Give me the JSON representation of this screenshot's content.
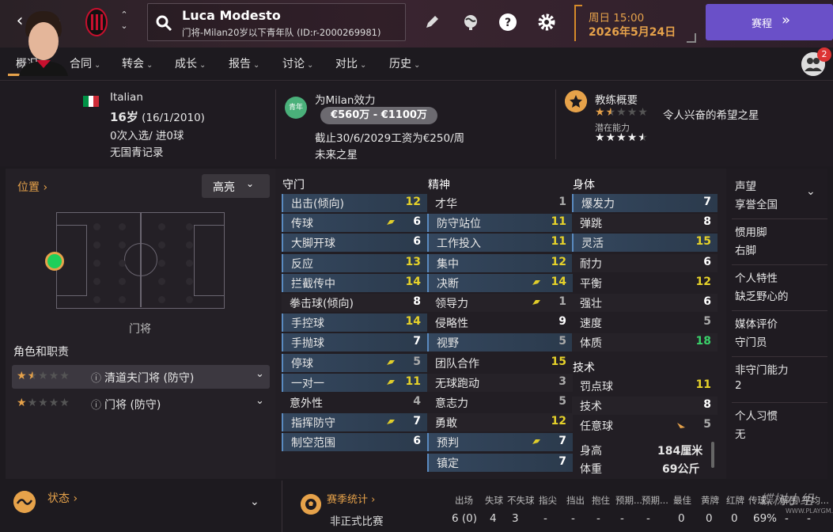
{
  "topbar": {
    "player_name": "Luca Modesto",
    "player_sub": "门将-Milan20岁以下青年队 (ID:r-2000269981)",
    "date_line1": "周日 15:00",
    "date_line2": "2026年5月24日",
    "continue_label": "赛程",
    "notification_count": "2"
  },
  "tabs": [
    {
      "label": "概况"
    },
    {
      "label": "合同"
    },
    {
      "label": "转会"
    },
    {
      "label": "成长"
    },
    {
      "label": "报告"
    },
    {
      "label": "讨论"
    },
    {
      "label": "对比"
    },
    {
      "label": "历史"
    }
  ],
  "header": {
    "nationality": "Italian",
    "age": "16岁",
    "dob": "(16/1/2010)",
    "caps": "0次入选/ 进0球",
    "youth_record": "无国青记录",
    "youth_badge": "青年",
    "plays_for": "为Milan效力",
    "value_range": "€560万 - €1100万",
    "contract": "截止30/6/2029工资为€250/周",
    "potential_label": "未来之星",
    "coach_title": "教练概要",
    "coach_ability_stars": 1.5,
    "coach_desc": "令人兴奋的希望之星",
    "potential_title": "潜在能力",
    "potential_stars": 4.5
  },
  "left": {
    "position_label": "位置",
    "highlight_label": "高亮",
    "position_name": "门将",
    "roles_title": "角色和职责",
    "roles": [
      {
        "name": "清道夫门将 (防守)",
        "stars": 1.5
      },
      {
        "name": "门将 (防守)",
        "stars": 1
      }
    ]
  },
  "attributes": {
    "goalkeeping": {
      "title": "守门",
      "items": [
        {
          "label": "出击(倾向)",
          "value": "12",
          "color": "#e6d22a",
          "hl": true,
          "arrow": false
        },
        {
          "label": "传球",
          "value": "6",
          "color": "#ffffff",
          "hl": true,
          "arrow": true
        },
        {
          "label": "大脚开球",
          "value": "6",
          "color": "#ffffff",
          "hl": true,
          "arrow": false
        },
        {
          "label": "反应",
          "value": "13",
          "color": "#e6d22a",
          "hl": true,
          "arrow": false
        },
        {
          "label": "拦截传中",
          "value": "14",
          "color": "#e6d22a",
          "hl": true,
          "arrow": false
        },
        {
          "label": "拳击球(倾向)",
          "value": "8",
          "color": "#ffffff",
          "hl": false,
          "arrow": false
        },
        {
          "label": "手控球",
          "value": "14",
          "color": "#e6d22a",
          "hl": true,
          "arrow": false
        },
        {
          "label": "手抛球",
          "value": "7",
          "color": "#ffffff",
          "hl": true,
          "arrow": false
        },
        {
          "label": "停球",
          "value": "5",
          "color": "#aaaaaa",
          "hl": true,
          "arrow": true
        },
        {
          "label": "一对一",
          "value": "11",
          "color": "#e6d22a",
          "hl": true,
          "arrow": true
        },
        {
          "label": "意外性",
          "value": "4",
          "color": "#aaaaaa",
          "hl": false,
          "arrow": false
        },
        {
          "label": "指挥防守",
          "value": "7",
          "color": "#ffffff",
          "hl": true,
          "arrow": true
        },
        {
          "label": "制空范围",
          "value": "6",
          "color": "#ffffff",
          "hl": true,
          "arrow": false
        }
      ]
    },
    "mental": {
      "title": "精神",
      "items": [
        {
          "label": "才华",
          "value": "1",
          "color": "#aaaaaa",
          "hl": false,
          "arrow": false
        },
        {
          "label": "防守站位",
          "value": "11",
          "color": "#e6d22a",
          "hl": true,
          "arrow": false
        },
        {
          "label": "工作投入",
          "value": "11",
          "color": "#e6d22a",
          "hl": true,
          "arrow": false
        },
        {
          "label": "集中",
          "value": "12",
          "color": "#e6d22a",
          "hl": true,
          "arrow": false
        },
        {
          "label": "决断",
          "value": "14",
          "color": "#e6d22a",
          "hl": true,
          "arrow": true
        },
        {
          "label": "领导力",
          "value": "1",
          "color": "#aaaaaa",
          "hl": false,
          "arrow": true
        },
        {
          "label": "侵略性",
          "value": "9",
          "color": "#ffffff",
          "hl": false,
          "arrow": false
        },
        {
          "label": "视野",
          "value": "5",
          "color": "#aaaaaa",
          "hl": true,
          "arrow": false
        },
        {
          "label": "团队合作",
          "value": "15",
          "color": "#e6d22a",
          "hl": false,
          "arrow": false
        },
        {
          "label": "无球跑动",
          "value": "3",
          "color": "#aaaaaa",
          "hl": false,
          "arrow": false
        },
        {
          "label": "意志力",
          "value": "5",
          "color": "#aaaaaa",
          "hl": false,
          "arrow": false
        },
        {
          "label": "勇敢",
          "value": "12",
          "color": "#e6d22a",
          "hl": false,
          "arrow": false
        },
        {
          "label": "预判",
          "value": "7",
          "color": "#ffffff",
          "hl": true,
          "arrow": true
        },
        {
          "label": "镇定",
          "value": "7",
          "color": "#ffffff",
          "hl": true,
          "arrow": false
        }
      ]
    },
    "physical": {
      "title": "身体",
      "items": [
        {
          "label": "爆发力",
          "value": "7",
          "color": "#ffffff",
          "hl": true,
          "arrow": false
        },
        {
          "label": "弹跳",
          "value": "8",
          "color": "#ffffff",
          "hl": false,
          "arrow": false
        },
        {
          "label": "灵活",
          "value": "15",
          "color": "#e6d22a",
          "hl": true,
          "arrow": false
        },
        {
          "label": "耐力",
          "value": "6",
          "color": "#ffffff",
          "hl": false,
          "arrow": false
        },
        {
          "label": "平衡",
          "value": "12",
          "color": "#e6d22a",
          "hl": false,
          "arrow": false
        },
        {
          "label": "强壮",
          "value": "6",
          "color": "#ffffff",
          "hl": false,
          "arrow": false
        },
        {
          "label": "速度",
          "value": "5",
          "color": "#aaaaaa",
          "hl": false,
          "arrow": false
        },
        {
          "label": "体质",
          "value": "18",
          "color": "#3ad16a",
          "hl": false,
          "arrow": false
        }
      ]
    },
    "technical": {
      "title": "技术",
      "items": [
        {
          "label": "罚点球",
          "value": "11",
          "color": "#e6d22a",
          "hl": false,
          "arrow": false
        },
        {
          "label": "技术",
          "value": "8",
          "color": "#ffffff",
          "hl": false,
          "arrow": false
        },
        {
          "label": "任意球",
          "value": "5",
          "color": "#aaaaaa",
          "hl": false,
          "arrow": true
        }
      ]
    },
    "height_label": "身高",
    "height_value": "184厘米",
    "weight_label": "体重",
    "weight_value": "69公斤"
  },
  "rightinfo": [
    {
      "title": "声望",
      "value": "享誉全国"
    },
    {
      "title": "惯用脚",
      "value": "右脚"
    },
    {
      "title": "个人特性",
      "value": "缺乏野心的"
    },
    {
      "title": "媒体评价",
      "value": "守门员"
    },
    {
      "title": "非守门能力",
      "value": "2"
    },
    {
      "title": "个人习惯",
      "value": "无"
    }
  ],
  "bottom": {
    "status_label": "状态",
    "stats_label": "赛季统计",
    "columns": [
      "出场",
      "失球",
      "不失球",
      "指尖",
      "挡出",
      "抱住",
      "预期...",
      "预期...",
      "最佳",
      "黄牌",
      "红牌",
      "传球...",
      "解围",
      "平均..."
    ],
    "row_label": "非正式比赛",
    "row_values": [
      "6 (0)",
      "4",
      "3",
      "-",
      "-",
      "-",
      "-",
      "-",
      "0",
      "0",
      "0",
      "69%",
      "-",
      "-"
    ]
  },
  "watermark": {
    "text": "蝶树小组",
    "site": "WWW.PLAYGM.CC"
  },
  "colors": {
    "accent": "#e6a24a",
    "continue": "#6a50c8",
    "high": "#e6d22a",
    "elite": "#3ad16a"
  }
}
